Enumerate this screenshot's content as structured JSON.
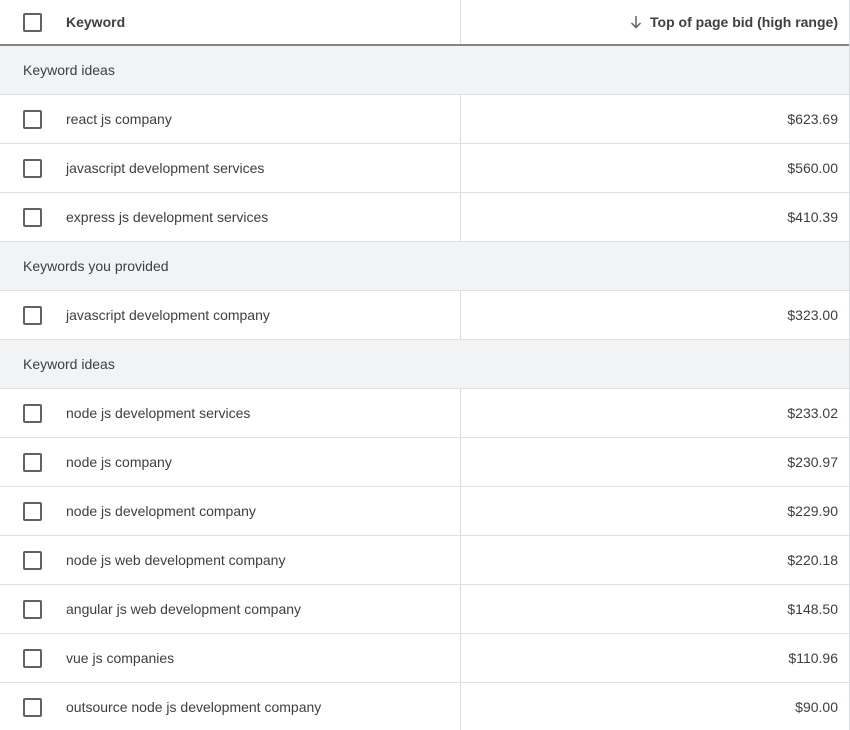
{
  "header": {
    "keyword_label": "Keyword",
    "bid_label": "Top of page bid (high range)",
    "sort_icon": "arrow-down-icon"
  },
  "groups": [
    {
      "title": "Keyword ideas",
      "rows": [
        {
          "keyword": "react js company",
          "bid": "$623.69"
        },
        {
          "keyword": "javascript development services",
          "bid": "$560.00"
        },
        {
          "keyword": "express js development services",
          "bid": "$410.39"
        }
      ]
    },
    {
      "title": "Keywords you provided",
      "rows": [
        {
          "keyword": "javascript development company",
          "bid": "$323.00"
        }
      ]
    },
    {
      "title": "Keyword ideas",
      "rows": [
        {
          "keyword": "node js development services",
          "bid": "$233.02"
        },
        {
          "keyword": "node js company",
          "bid": "$230.97"
        },
        {
          "keyword": "node js development company",
          "bid": "$229.90"
        },
        {
          "keyword": "node js web development company",
          "bid": "$220.18"
        },
        {
          "keyword": "angular js web development company",
          "bid": "$148.50"
        },
        {
          "keyword": "vue js companies",
          "bid": "$110.96"
        },
        {
          "keyword": "outsource node js development company",
          "bid": "$90.00"
        }
      ]
    }
  ]
}
